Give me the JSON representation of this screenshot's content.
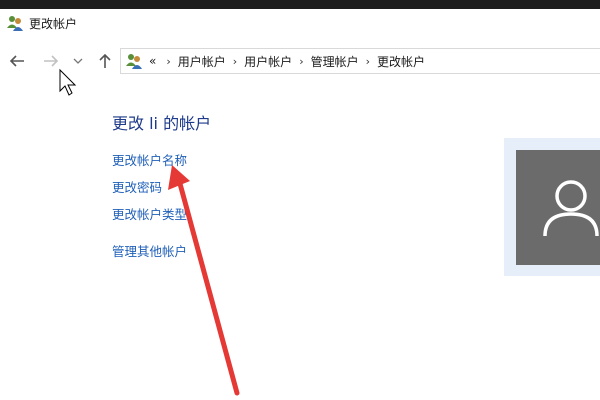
{
  "window": {
    "title": "更改帐户"
  },
  "address_bar": {
    "overflow": "«",
    "separator": "›",
    "breadcrumbs": [
      "用户帐户",
      "用户帐户",
      "管理帐户",
      "更改帐户"
    ]
  },
  "main": {
    "heading": "更改 li 的帐户",
    "links": {
      "change_name": "更改帐户名称",
      "change_password": "更改密码",
      "change_type": "更改帐户类型",
      "manage_other": "管理其他帐户"
    }
  },
  "colors": {
    "link": "#1f5fb8",
    "heading": "#1e3a8a",
    "avatar_bg": "#6b6b6b",
    "avatar_panel": "#e6eff9",
    "annotation_arrow": "#e53935"
  },
  "icons": {
    "window": "users-icon",
    "back": "arrow-left-icon",
    "forward": "arrow-right-icon",
    "recent": "chevron-down-icon",
    "up": "arrow-up-icon",
    "avatar": "user-silhouette-icon"
  }
}
